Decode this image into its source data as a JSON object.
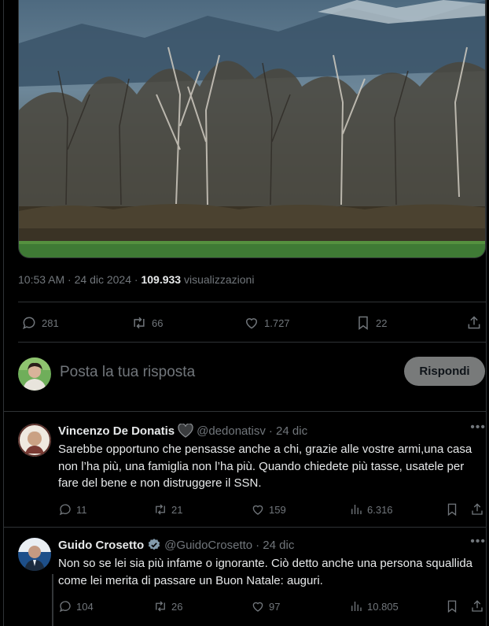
{
  "post": {
    "time": "10:53 AM",
    "date": "24 dic 2024",
    "views_count": "109.933",
    "views_label": "visualizzazioni",
    "actions": {
      "replies": "281",
      "reposts": "66",
      "likes": "1.727",
      "bookmarks": "22"
    }
  },
  "reply_box": {
    "placeholder": "Posta la tua risposta",
    "button_label": "Rispondi"
  },
  "replies": [
    {
      "name": "Vincenzo De Donatis",
      "handle": "@dedonatisv",
      "date": "· 24 dic",
      "text": "Sarebbe opportuno che pensasse anche a chi, grazie alle vostre armi,una casa non l’ha più, una famiglia non l’ha più. Quando chiedete più tasse, usatele per fare del bene e non distruggere il SSN.",
      "replies": "11",
      "reposts": "21",
      "likes": "159",
      "views": "6.316"
    },
    {
      "name": "Guido Crosetto",
      "handle": "@GuidoCrosetto",
      "date": "· 24 dic",
      "text": "Non so se lei sia più infame o ignorante. Ciò detto anche una persona squallida come lei merita di passare un Buon Natale: auguri.",
      "replies": "104",
      "reposts": "26",
      "likes": "97",
      "views": "10.805"
    }
  ],
  "icons": {
    "reply": "speech-bubble-icon",
    "repost": "repost-arrows-icon",
    "like": "heart-icon",
    "views": "bar-chart-icon",
    "bookmark": "bookmark-icon",
    "share": "share-icon",
    "more": "more-dots-icon",
    "verified": "verified-badge-icon",
    "heart_badge": "black-heart-icon"
  },
  "colors": {
    "background": "#000000",
    "text": "#e7e9ea",
    "muted": "#71767b",
    "border": "#2f3336",
    "button_disabled": "#787a7a",
    "verified_badge": "#829aab"
  }
}
